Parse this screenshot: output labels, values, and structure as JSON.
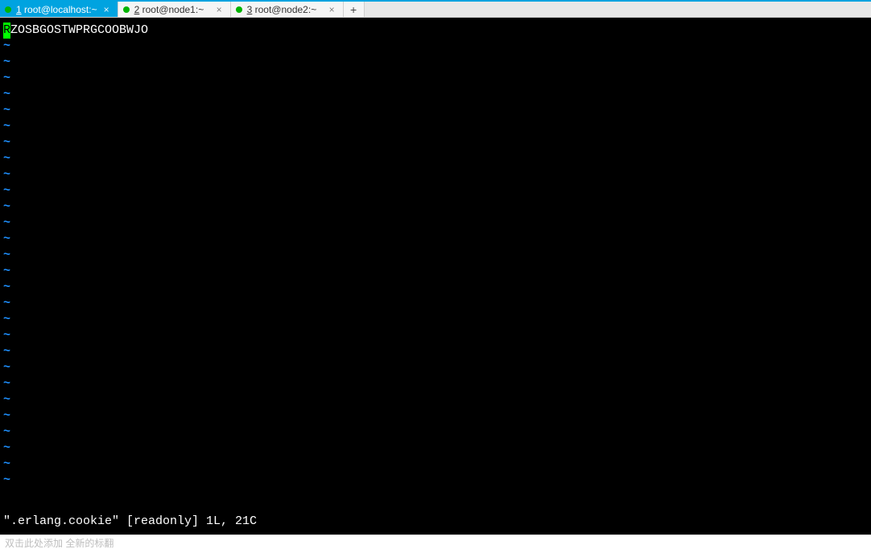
{
  "tabs": [
    {
      "index_underline": "1",
      "rest": " root@localhost:~",
      "active": true
    },
    {
      "index_underline": "2",
      "rest": " root@node1:~",
      "active": false
    },
    {
      "index_underline": "3",
      "rest": " root@node2:~",
      "active": false
    }
  ],
  "newtab_glyph": "+",
  "tab_close_glyph": "×",
  "editor": {
    "cursor_char": "R",
    "line1_rest": "ZOSBGOSTWPRGCOOBWJO",
    "tilde": "~",
    "empty_lines": 28,
    "status": "\".erlang.cookie\" [readonly] 1L, 21C"
  },
  "footer_text": "双击此处添加    全新的标翻"
}
